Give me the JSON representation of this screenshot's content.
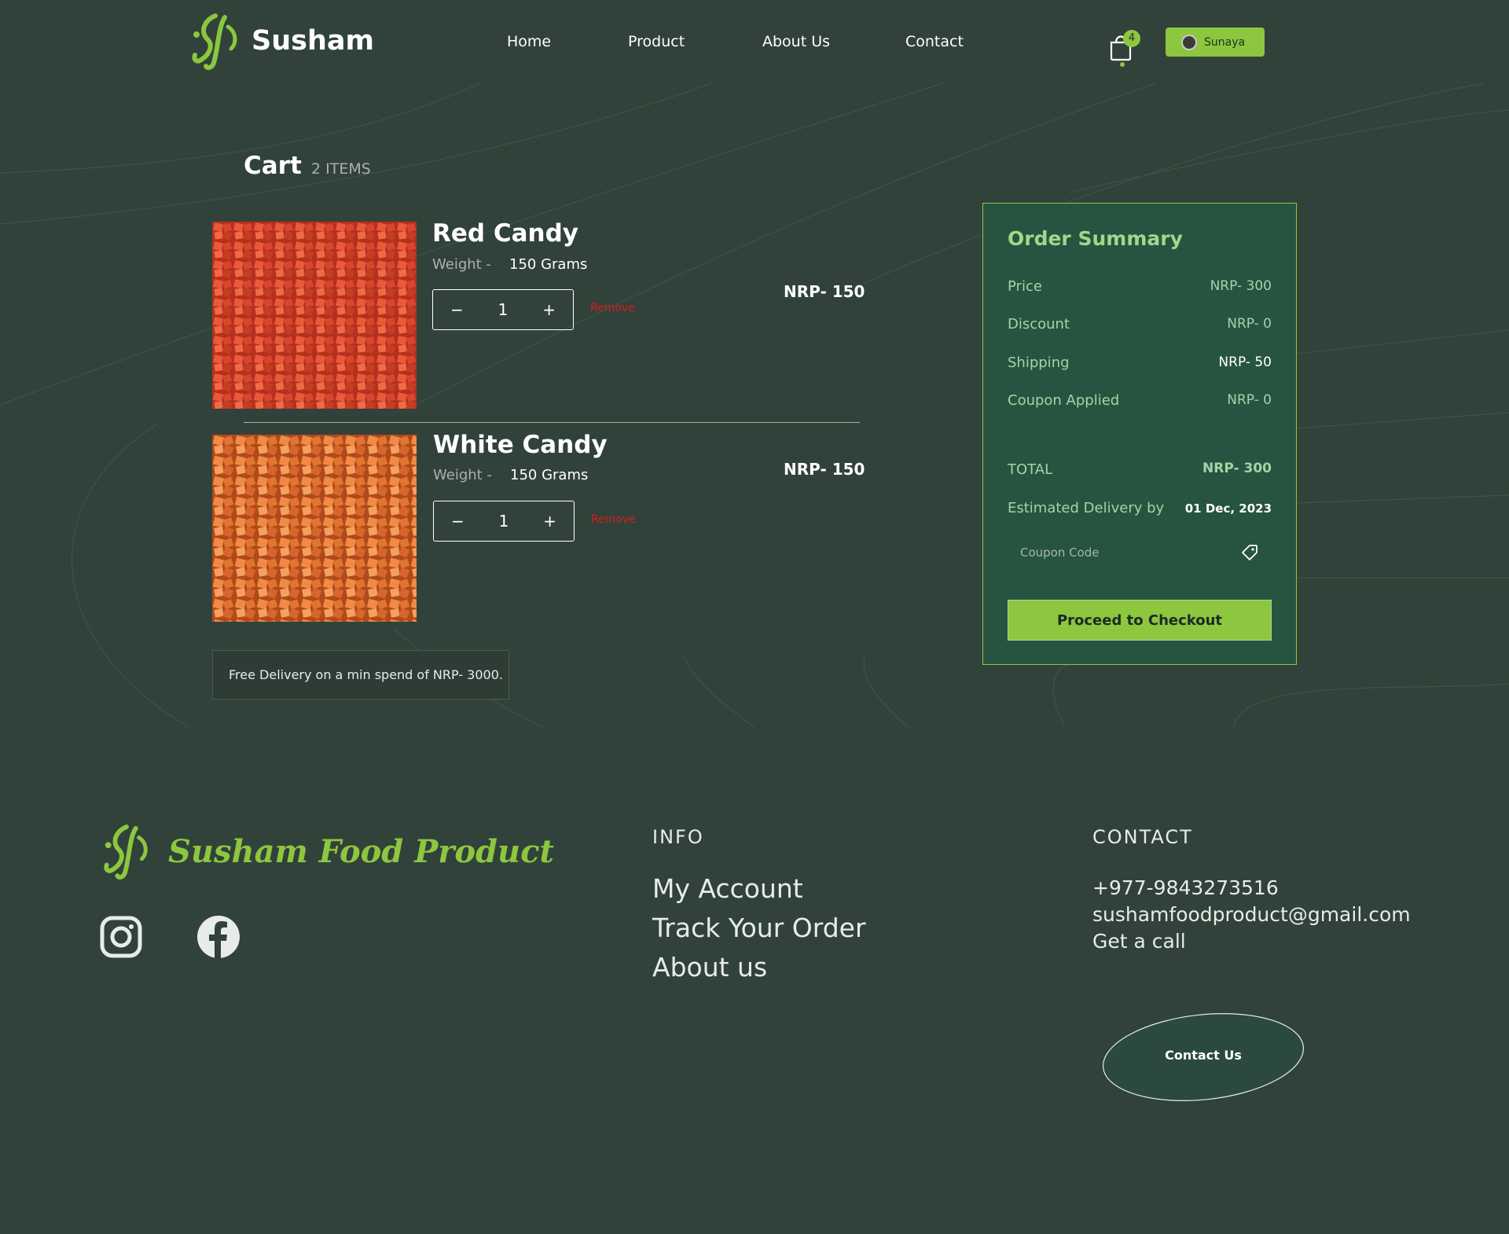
{
  "brand": {
    "name": "Susham"
  },
  "nav": {
    "home": "Home",
    "product": "Product",
    "about": "About Us",
    "contact": "Contact"
  },
  "cart_badge": "4",
  "user": {
    "name": "Sunaya"
  },
  "cart": {
    "title": "Cart",
    "count": "2 ITEMS"
  },
  "items": [
    {
      "name": "Red Candy",
      "weight_label": "Weight -",
      "weight": "150 Grams",
      "qty": "1",
      "remove": "Remove",
      "price": "NRP- 150"
    },
    {
      "name": "White Candy",
      "weight_label": "Weight -",
      "weight": "150 Grams",
      "qty": "1",
      "remove": "Remove",
      "price": "NRP- 150"
    }
  ],
  "qty_minus": "−",
  "qty_plus": "+",
  "free_delivery": "Free Delivery on a min spend of NRP- 3000.",
  "summary": {
    "title": "Order Summary",
    "price_label": "Price",
    "price": "NRP- 300",
    "discount_label": "Discount",
    "discount": "NRP- 0",
    "shipping_label": "Shipping",
    "shipping": "NRP- 50",
    "coupon_label": "Coupon Applied",
    "coupon": "NRP- 0",
    "total_label": "TOTAL",
    "total": "NRP- 300",
    "delivery_label": "Estimated Delivery by",
    "delivery": "01 Dec, 2023",
    "coupon_placeholder": "Coupon Code",
    "checkout": "Proceed to Checkout"
  },
  "footer": {
    "brand": "Susham Food Product",
    "info_head": "INFO",
    "info_links": [
      "My Account",
      "Track Your Order",
      "About us"
    ],
    "contact_head": "CONTACT",
    "phone": "+977-9843273516",
    "email": "sushamfoodproduct@gmail.com",
    "call": "Get a call",
    "contact_button": "Contact Us"
  },
  "colors": {
    "background": "#31423a",
    "accent": "#8dc63f",
    "summary_bg": "#275441",
    "remove": "#d71d1d"
  }
}
